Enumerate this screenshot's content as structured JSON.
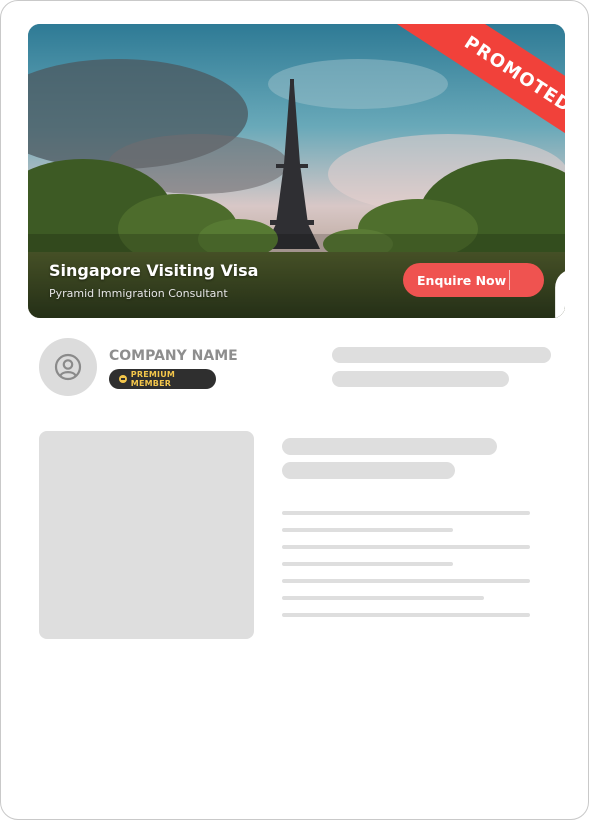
{
  "banner": {
    "ribbon_label": "PROMOTED",
    "title": "Singapore Visiting Visa",
    "subtitle": "Pyramid Immigration Consultant",
    "enquire_label": "Enquire Now",
    "image_icon": "eiffel-tower-photo",
    "bookmark_icon": "bookmark-icon"
  },
  "company": {
    "name": "COMPANY NAME",
    "badge": "PREMIUM MEMBER",
    "avatar_icon": "user-circle-icon"
  },
  "colors": {
    "accent": "#ef5350",
    "ribbon": "#f1413a",
    "badge_bg": "#2f2f2f",
    "badge_text": "#f3c64b",
    "skeleton": "#dedede"
  }
}
